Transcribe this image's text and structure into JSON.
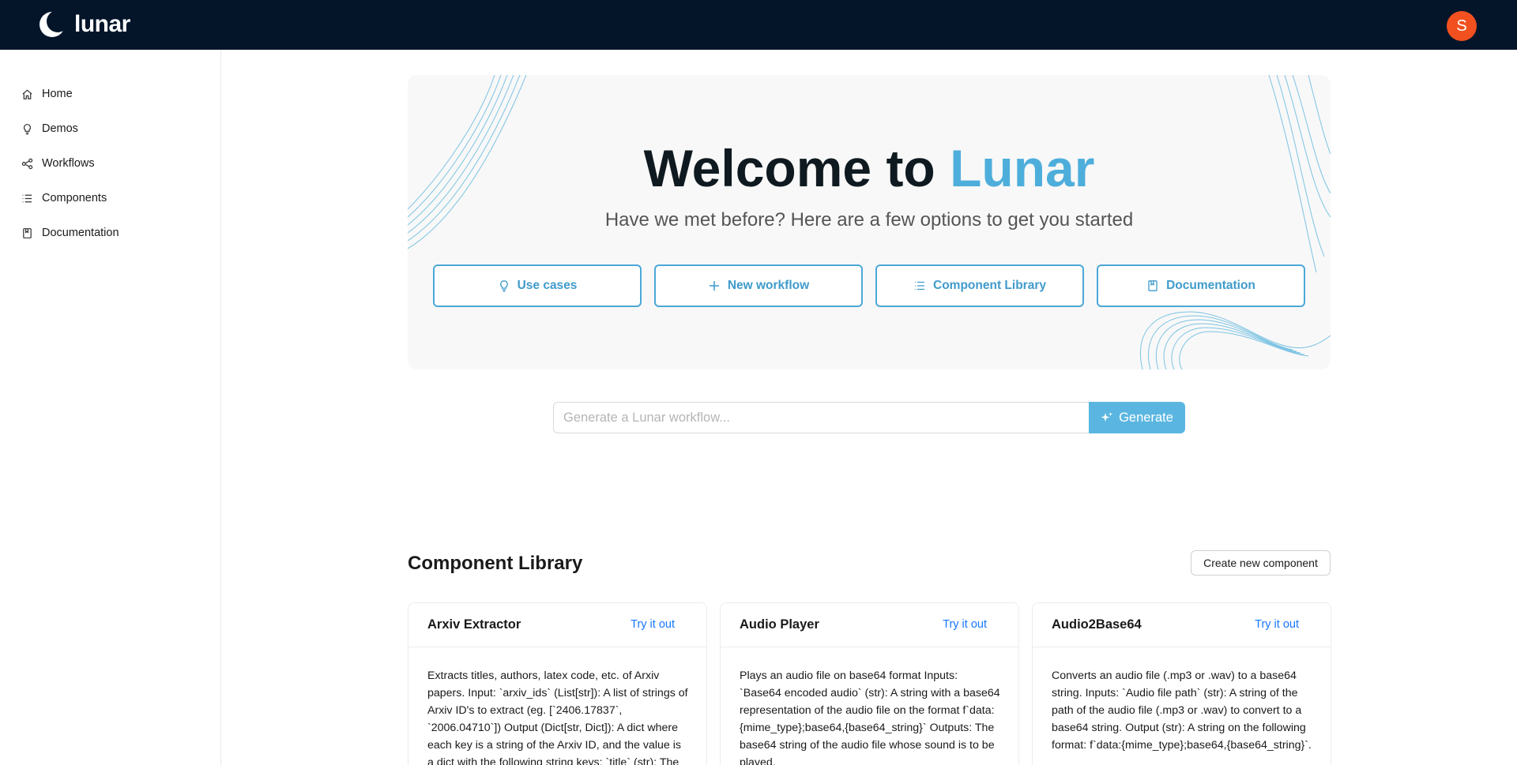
{
  "brand": {
    "name": "lunar",
    "accent": "#4eaedb",
    "topbar_bg": "#04152a"
  },
  "user": {
    "initial": "S",
    "avatar_color": "#f2511f"
  },
  "sidebar": {
    "items": [
      {
        "label": "Home",
        "icon": "home-icon"
      },
      {
        "label": "Demos",
        "icon": "lightbulb-icon"
      },
      {
        "label": "Workflows",
        "icon": "workflow-icon"
      },
      {
        "label": "Components",
        "icon": "list-icon"
      },
      {
        "label": "Documentation",
        "icon": "book-icon"
      }
    ]
  },
  "hero": {
    "title_prefix": "Welcome to ",
    "title_accent": "Lunar",
    "subtitle": "Have we met before? Here are a few options to get you started",
    "buttons": [
      {
        "label": "Use cases",
        "icon": "lightbulb-icon"
      },
      {
        "label": "New workflow",
        "icon": "plus-icon"
      },
      {
        "label": "Component Library",
        "icon": "list-icon"
      },
      {
        "label": "Documentation",
        "icon": "book-icon"
      }
    ]
  },
  "generate": {
    "placeholder": "Generate a Lunar workflow...",
    "button_label": "Generate",
    "button_icon": "sparkle-icon"
  },
  "library": {
    "title": "Component Library",
    "create_label": "Create new component",
    "cards": [
      {
        "title": "Arxiv Extractor",
        "try_label": "Try it out",
        "description": "Extracts titles, authors, latex code, etc. of Arxiv papers. Input: `arxiv_ids` (List[str]): A list of strings of Arxiv ID's to extract (eg. [`2406.17837`, `2006.04710`]) Output (Dict[str, Dict]): A dict where each key is a string of the Arxiv ID, and the value is a dict with the following string keys: `title` (str): The"
      },
      {
        "title": "Audio Player",
        "try_label": "Try it out",
        "description": "Plays an audio file on base64 format Inputs: `Base64 encoded audio` (str): A string with a base64 representation of the audio file on the format f`data:{mime_type};base64,{base64_string}` Outputs: The base64 string of the audio file whose sound is to be played."
      },
      {
        "title": "Audio2Base64",
        "try_label": "Try it out",
        "description": "Converts an audio file (.mp3 or .wav) to a base64 string. Inputs: `Audio file path` (str): A string of the path of the audio file (.mp3 or .wav) to convert to a base64 string. Output (str): A string on the following format: f`data:{mime_type};base64,{base64_string}`."
      }
    ]
  }
}
